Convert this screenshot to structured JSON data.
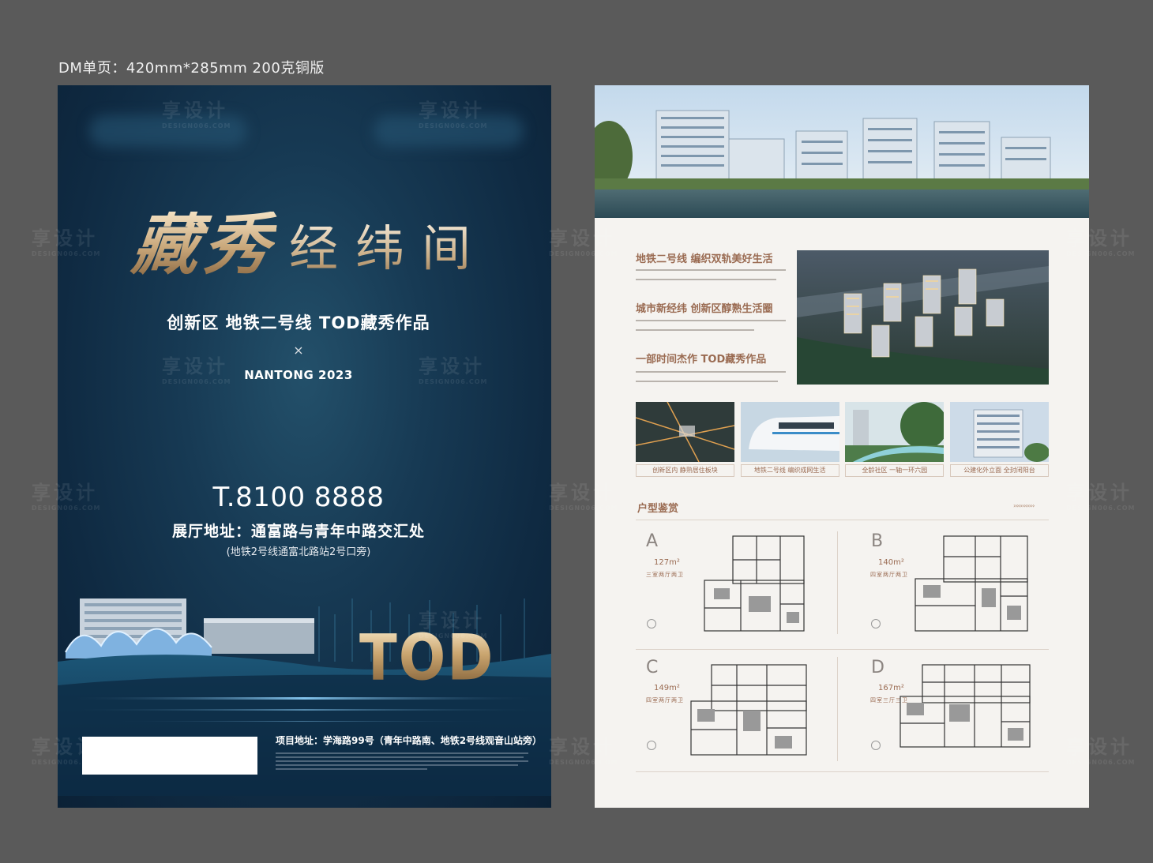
{
  "spec_label": "DM单页：420mm*285mm  200克铜版",
  "front": {
    "title_callig": "藏秀",
    "title_plain": "经纬间",
    "subtitle": "创新区 地铁二号线 TOD藏秀作品",
    "cross": "×",
    "city_year": "NANTONG 2023",
    "phone": "T.8100 8888",
    "hall_address": "展厅地址：通富路与青年中路交汇处",
    "hall_note": "(地铁2号线通富北路站2号口旁)",
    "tod_word": "TOD",
    "project_address": "项目地址：学海路99号（青年中路南、地铁2号线观音山站旁）"
  },
  "back": {
    "blurbs": [
      {
        "title": "地铁二号线 编织双轨美好生活"
      },
      {
        "title": "城市新经纬 创新区醇熟生活圈"
      },
      {
        "title": "一部时间杰作 TOD藏秀作品"
      }
    ],
    "thumbs": [
      {
        "caption": "创新区内 静熟居住板块"
      },
      {
        "caption": "地铁二号线 编织成网生活"
      },
      {
        "caption": "全龄社区 一轴一环六园"
      },
      {
        "caption": "公建化外立面 全封闭阳台"
      }
    ],
    "section_title": "户型鉴赏",
    "section_arrows": "››››››››››››",
    "plans": [
      {
        "letter": "A",
        "area": "127m²",
        "type": "三室两厅两卫"
      },
      {
        "letter": "B",
        "area": "140m²",
        "type": "四室两厅两卫"
      },
      {
        "letter": "C",
        "area": "149m²",
        "type": "四室两厅两卫"
      },
      {
        "letter": "D",
        "area": "167m²",
        "type": "四室三厅三卫"
      }
    ]
  },
  "watermark": {
    "text": "享设计",
    "sub": "DESIGN006.COM"
  },
  "colors": {
    "background": "#5a5a5a",
    "front_navy": "#0f2a42",
    "gold": "#c8a679",
    "back_accent": "#9a6b52"
  }
}
